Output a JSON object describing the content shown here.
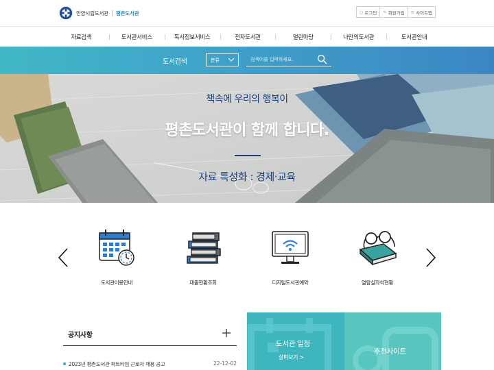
{
  "header": {
    "logo_name": "안양시립도서관",
    "logo_sub": "평촌도서관",
    "util": [
      {
        "label": "로그인",
        "icon": "person-icon"
      },
      {
        "label": "회원가입",
        "icon": "pen-icon"
      },
      {
        "label": "사이트맵",
        "icon": "list-icon"
      }
    ]
  },
  "nav": {
    "items": [
      "자료검색",
      "도서관서비스",
      "독서정보서비스",
      "전자도서관",
      "열린마당",
      "나만의도서관",
      "도서관안내"
    ]
  },
  "search": {
    "label": "도서검색",
    "select_value": "분류",
    "placeholder": "검색어를 입력하세요."
  },
  "hero": {
    "line1": "책속에 우리의 행복이",
    "line2": "평촌도서관이 함께 합니다.",
    "line3": "자료 특성화 : 경제·교육"
  },
  "quick_menu": {
    "items": [
      {
        "label": "도서관이용안내",
        "icon": "calendar-clock-icon"
      },
      {
        "label": "대출현황조회",
        "icon": "book-stack-icon"
      },
      {
        "label": "디지털도서관예약",
        "icon": "monitor-wifi-icon"
      },
      {
        "label": "열람실좌석현황",
        "icon": "book-glasses-icon"
      }
    ]
  },
  "notice": {
    "title": "공지사항",
    "items": [
      {
        "text": "2023년 평촌도서관 파트타임 근로자 채용 공고",
        "date": "22-12-02"
      }
    ]
  },
  "cards": {
    "calendar": {
      "title": "도서관 일정",
      "link": "살펴보기 >"
    },
    "recommend": {
      "title": "추천사이트"
    }
  },
  "colors": {
    "accent": "#2a8fbf",
    "searchbar_start": "#41b8c6",
    "searchbar_end": "#3b86c2",
    "hero_text": "#1f3f7a",
    "card1": "#3fb5bd",
    "card2": "#58c5bf"
  }
}
